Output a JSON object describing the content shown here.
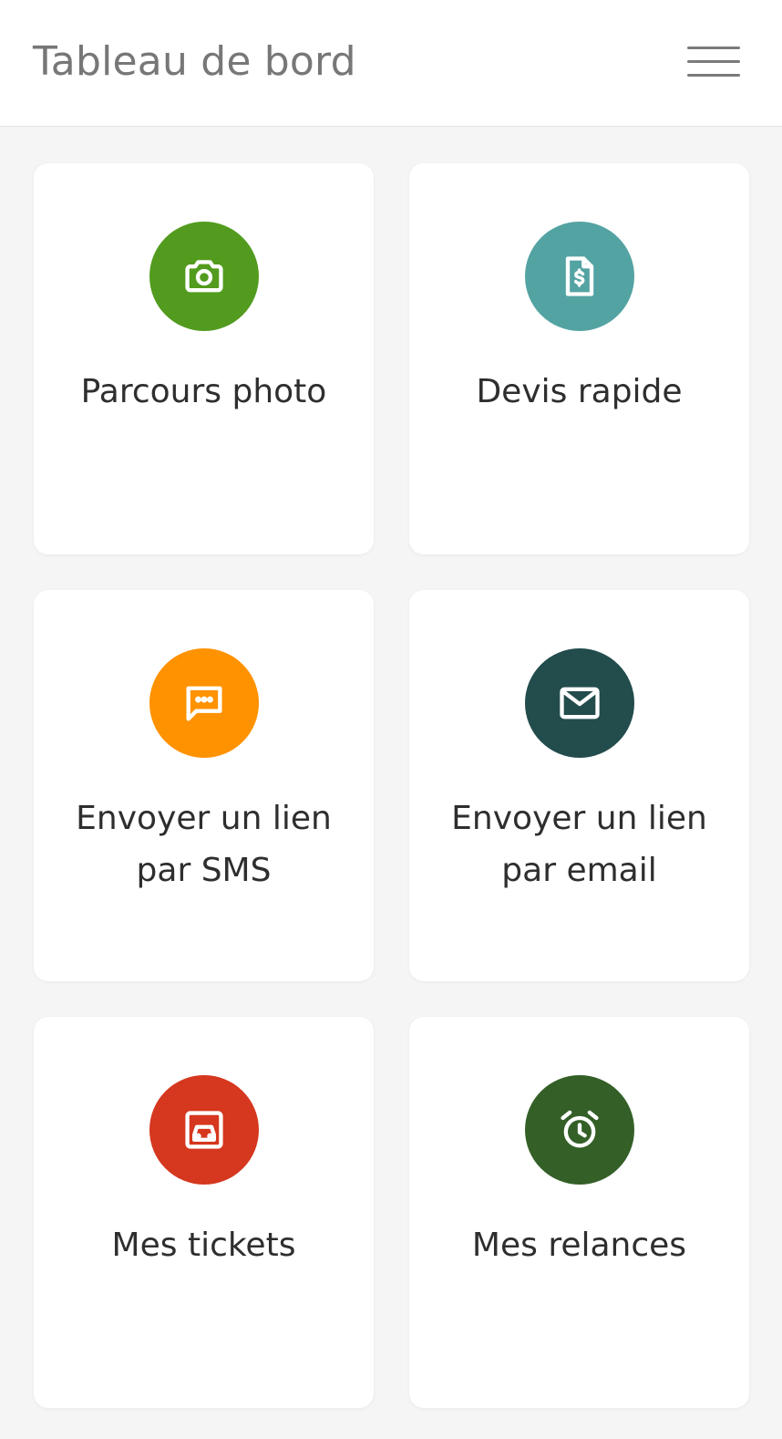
{
  "header": {
    "title": "Tableau de bord",
    "menu_icon": "hamburger-menu-icon"
  },
  "tiles": [
    {
      "label": "Parcours photo",
      "icon": "camera-icon",
      "color": "#529b1e"
    },
    {
      "label": "Devis rapide",
      "icon": "invoice-dollar-icon",
      "color": "#54a3a3"
    },
    {
      "label": "Envoyer un lien par SMS",
      "icon": "chat-bubble-icon",
      "color": "#ff9200"
    },
    {
      "label": "Envoyer un lien par email",
      "icon": "envelope-icon",
      "color": "#234c4c"
    },
    {
      "label": "Mes tickets",
      "icon": "car-ticket-icon",
      "color": "#d5371f"
    },
    {
      "label": "Mes relances",
      "icon": "alarm-clock-icon",
      "color": "#346028"
    }
  ]
}
